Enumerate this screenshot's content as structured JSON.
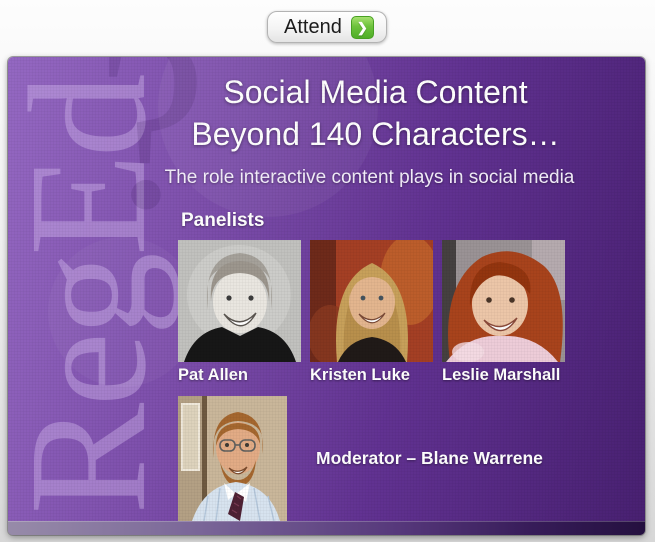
{
  "attend": {
    "label": "Attend",
    "arrow_icon": "❯"
  },
  "slide": {
    "watermark_text": "RegEd",
    "title_line1": "Social Media Content",
    "title_line2": "Beyond 140 Characters…",
    "subtitle": "The role interactive content plays in social media",
    "panelists_heading": "Panelists",
    "panelists": [
      {
        "name": "Pat Allen"
      },
      {
        "name": "Kristen Luke"
      },
      {
        "name": "Leslie Marshall"
      }
    ],
    "moderator_label": "Moderator – Blane Warrene"
  },
  "colors": {
    "slide_gradient_start": "#9468c2",
    "slide_gradient_end": "#482071",
    "attend_green": "#63bb35",
    "footer_bar_light": "#978ba9",
    "footer_bar_dark": "#24103f",
    "watermark": "#d4baee",
    "text_white": "#ffffff"
  }
}
